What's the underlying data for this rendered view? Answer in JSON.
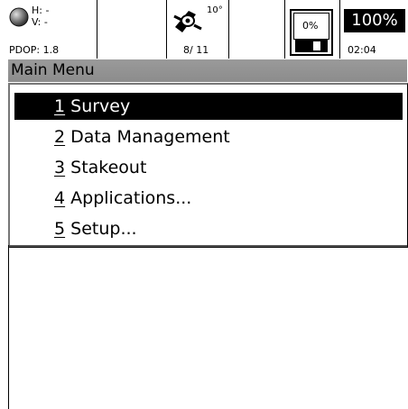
{
  "status": {
    "h_label": "H: -",
    "v_label": "V: -",
    "pdop": "PDOP: 1.8",
    "elevation_mask": "10°",
    "satellites": "8/ 11",
    "storage": "0%",
    "battery": "100%",
    "time": "02:04"
  },
  "header": {
    "title": "Main Menu"
  },
  "menu": {
    "items": [
      {
        "num": "1",
        "label": "Survey"
      },
      {
        "num": "2",
        "label": "Data Management"
      },
      {
        "num": "3",
        "label": "Stakeout"
      },
      {
        "num": "4",
        "label": "Applications..."
      },
      {
        "num": "5",
        "label": "Setup..."
      }
    ],
    "selected_index": 0
  },
  "icons": {
    "gps": "gps-status-icon",
    "sat": "satellite-icon",
    "disk": "floppy-disk-icon"
  }
}
